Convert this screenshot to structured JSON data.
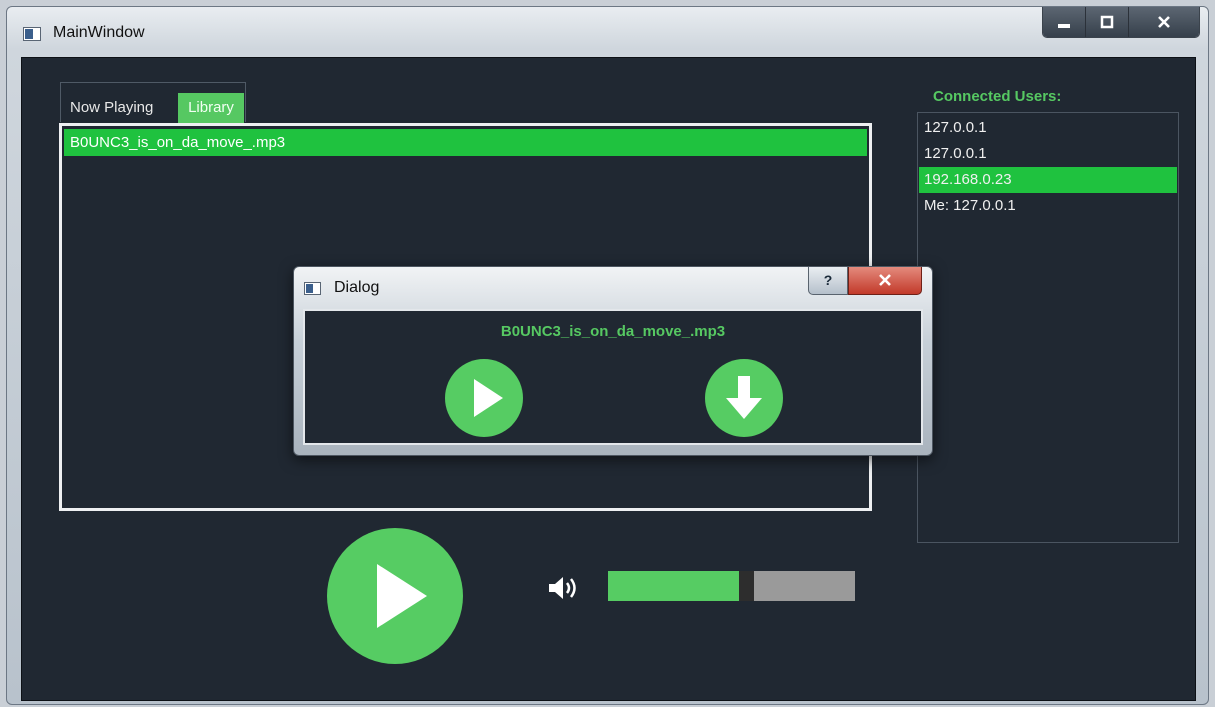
{
  "window": {
    "title": "MainWindow",
    "controls": {
      "minimize": "▁",
      "maximize": "□",
      "close": "X"
    }
  },
  "tabs": [
    {
      "label": "Now Playing",
      "selected": false
    },
    {
      "label": "Library",
      "selected": true
    }
  ],
  "library": {
    "items": [
      {
        "name": "B0UNC3_is_on_da_move_.mp3",
        "selected": true
      }
    ]
  },
  "users": {
    "title": "Connected Users:",
    "items": [
      {
        "label": "127.0.0.1",
        "selected": false
      },
      {
        "label": "127.0.0.1",
        "selected": false
      },
      {
        "label": "192.168.0.23",
        "selected": true
      },
      {
        "label": "Me: 127.0.0.1",
        "selected": false
      }
    ]
  },
  "player": {
    "play_icon": "play-icon",
    "volume_icon": "speaker-icon",
    "volume_level": 0.53
  },
  "dialog": {
    "title": "Dialog",
    "help": "?",
    "close": "X",
    "filename": "B0UNC3_is_on_da_move_.mp3",
    "play_icon": "play-icon",
    "download_icon": "download-arrow-icon"
  },
  "colors": {
    "accent": "#56cc63",
    "selection": "#1fc23f",
    "background": "#202832"
  }
}
